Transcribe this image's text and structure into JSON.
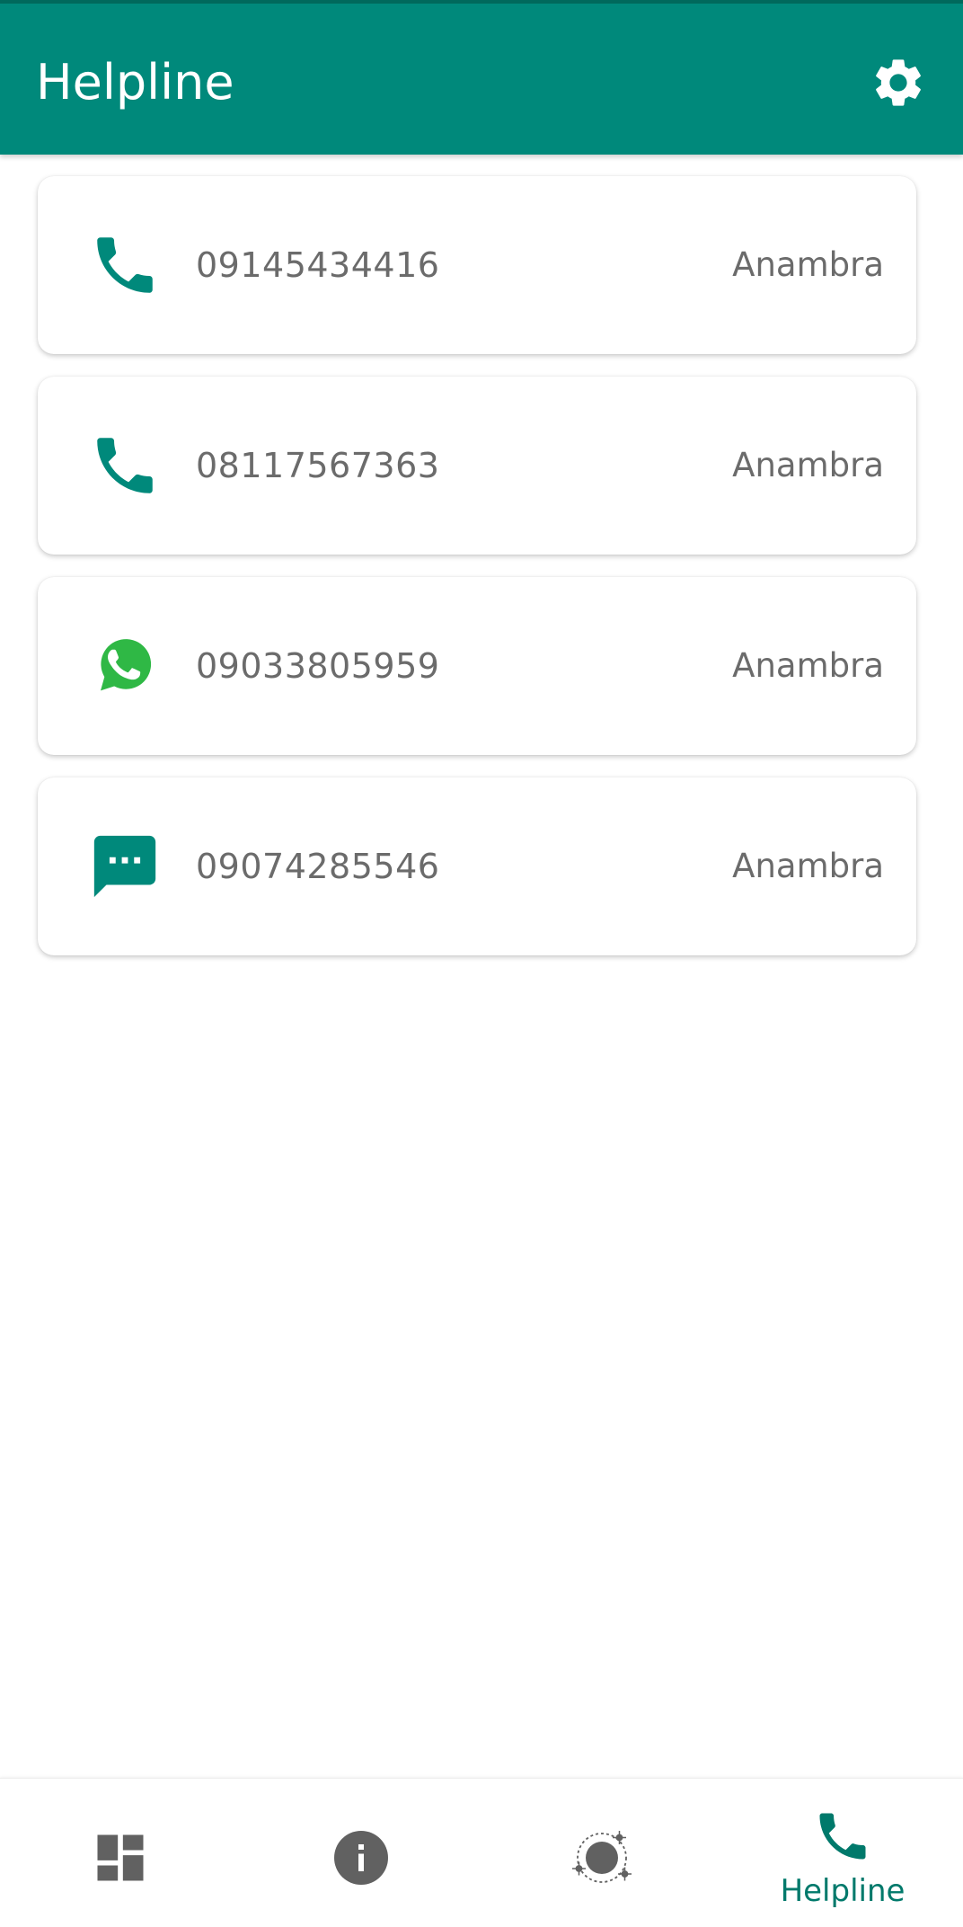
{
  "app_bar": {
    "title": "Helpline",
    "settings_icon": "gear-icon",
    "background": "#00897b"
  },
  "contacts": [
    {
      "icon": "phone-icon",
      "number": "09145434416",
      "region": "Anambra"
    },
    {
      "icon": "phone-icon",
      "number": "08117567363",
      "region": "Anambra"
    },
    {
      "icon": "whatsapp-icon",
      "number": "09033805959",
      "region": "Anambra"
    },
    {
      "icon": "sms-icon",
      "number": "09074285546",
      "region": "Anambra"
    }
  ],
  "bottom_nav": {
    "items": [
      {
        "icon": "dashboard-icon",
        "label": "",
        "active": false
      },
      {
        "icon": "info-icon",
        "label": "",
        "active": false
      },
      {
        "icon": "virus-icon",
        "label": "",
        "active": false
      },
      {
        "icon": "phone-icon",
        "label": "Helpline",
        "active": true
      }
    ],
    "active_color": "#00796b",
    "inactive_color": "#616161"
  }
}
